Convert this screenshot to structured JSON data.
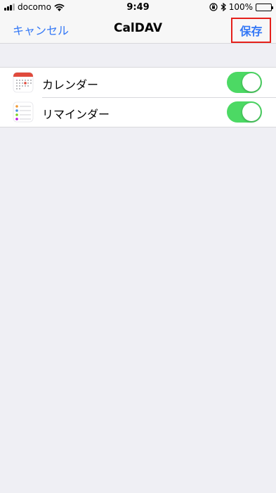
{
  "status_bar": {
    "carrier": "docomo",
    "time": "9:49",
    "battery_percent": "100%",
    "battery_level": 1.0
  },
  "nav": {
    "cancel_label": "キャンセル",
    "title": "CalDAV",
    "save_label": "保存"
  },
  "accent_color": "#3478f6",
  "toggle_color": "#4cd964",
  "highlight_color": "#e5201b",
  "items": [
    {
      "label": "カレンダー",
      "icon": "calendar-icon",
      "enabled": true
    },
    {
      "label": "リマインダー",
      "icon": "reminders-icon",
      "enabled": true
    }
  ]
}
